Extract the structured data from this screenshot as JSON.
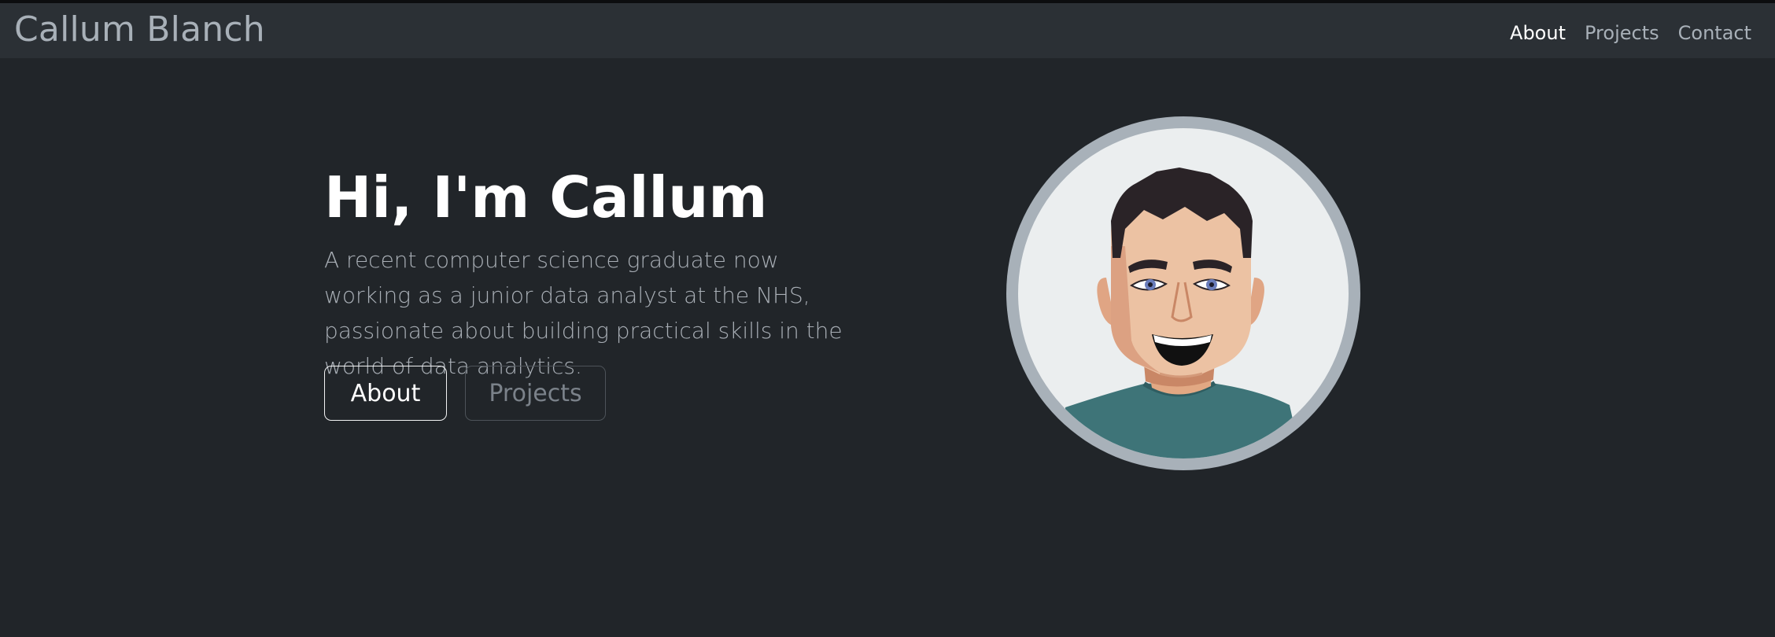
{
  "nav": {
    "brand": "Callum Blanch",
    "links": [
      {
        "label": "About",
        "active": true
      },
      {
        "label": "Projects",
        "active": false
      },
      {
        "label": "Contact",
        "active": false
      }
    ]
  },
  "hero": {
    "title": "Hi, I'm Callum",
    "lead": "A recent computer science graduate now working as a junior data analyst at the NHS, passionate about building practical skills in the world of data analytics.",
    "buttons": {
      "about": "About",
      "projects": "Projects"
    }
  },
  "avatar": {
    "icon": "cartoon-portrait-avatar"
  },
  "colors": {
    "background": "#212529",
    "navbar": "#2b3035",
    "text_muted": "#a8b0b8",
    "ring": "#a8b1b9",
    "shirt": "#3e7478",
    "skin": "#ecc2a3",
    "hair": "#2a2327"
  }
}
